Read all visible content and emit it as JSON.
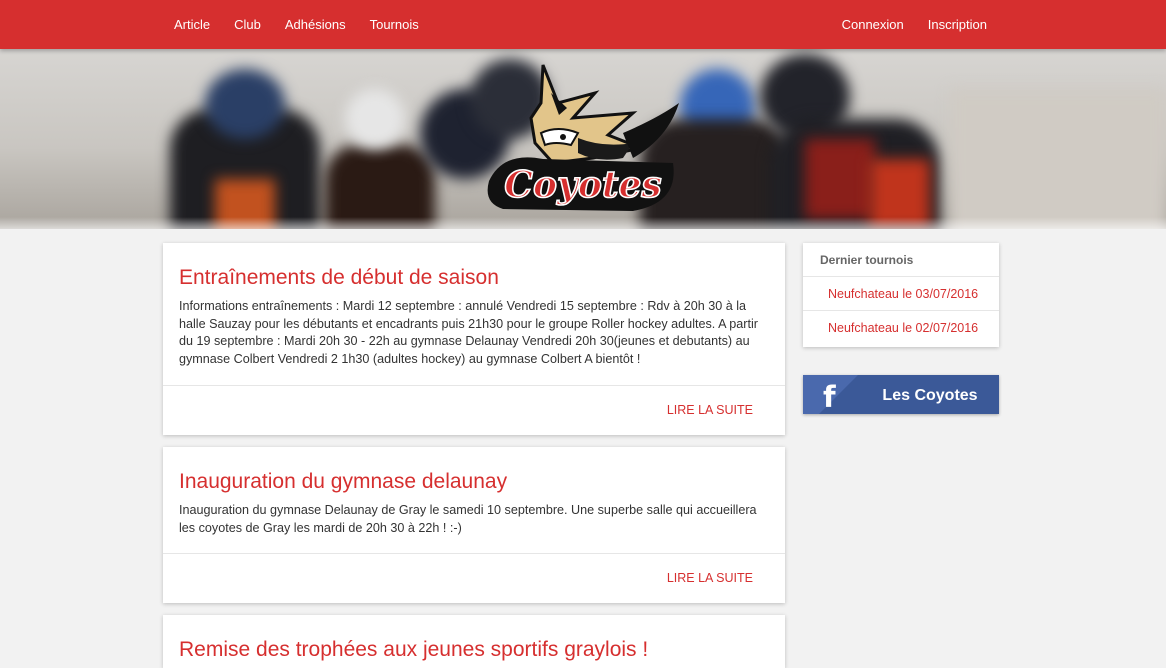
{
  "nav": {
    "left": [
      "Article",
      "Club",
      "Adhésions",
      "Tournois"
    ],
    "right": [
      "Connexion",
      "Inscription"
    ]
  },
  "hero": {
    "logo_text": "Coyotes"
  },
  "posts": [
    {
      "title": "Entraînements de début de saison",
      "excerpt": "Informations entraînements : Mardi 12 septembre : annulé Vendredi 15 septembre : Rdv à 20h 30 à la halle Sauzay pour les débutants et encadrants puis 21h30 pour le groupe Roller hockey adultes. A partir du 19 septembre : Mardi 20h 30 - 22h au gymnase Delaunay Vendredi 20h 30(jeunes et debutants) au gymnase Colbert Vendredi 2 1h30 (adultes hockey) au gymnase Colbert A bientôt !",
      "readmore": "LIRE LA SUITE"
    },
    {
      "title": "Inauguration du gymnase delaunay",
      "excerpt": "Inauguration du gymnase Delaunay de Gray le samedi 10 septembre. Une superbe salle qui accueillera les coyotes de Gray les mardi de 20h 30 à 22h ! :-)",
      "readmore": "LIRE LA SUITE"
    },
    {
      "title": "Remise des trophées aux jeunes sportifs graylois !"
    }
  ],
  "sidebar": {
    "heading": "Dernier tournois",
    "items": [
      "Neufchateau le 03/07/2016",
      "Neufchateau le 02/07/2016"
    ]
  },
  "facebook": {
    "icon": "f",
    "label": "Les Coyotes"
  },
  "colors": {
    "accent": "#d62f2f",
    "facebook": "#3b5998",
    "background": "#f2f2f2"
  }
}
